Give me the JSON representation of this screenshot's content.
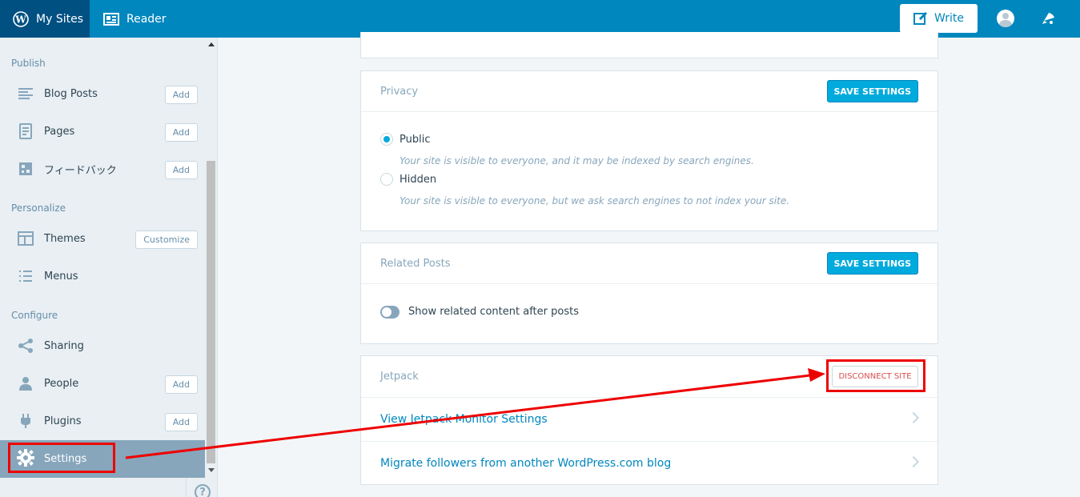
{
  "masterbar": {
    "my_sites": "My Sites",
    "reader": "Reader",
    "write": "Write"
  },
  "sidebar": {
    "sections": [
      {
        "heading": "Publish",
        "items": [
          {
            "label": "Blog Posts",
            "icon": "posts-icon",
            "button": "Add"
          },
          {
            "label": "Pages",
            "icon": "pages-icon",
            "button": "Add"
          },
          {
            "label": "フィードバック",
            "icon": "feedback-icon",
            "button": "Add"
          }
        ]
      },
      {
        "heading": "Personalize",
        "items": [
          {
            "label": "Themes",
            "icon": "themes-icon",
            "button": "Customize"
          },
          {
            "label": "Menus",
            "icon": "menus-icon",
            "button": ""
          }
        ]
      },
      {
        "heading": "Configure",
        "items": [
          {
            "label": "Sharing",
            "icon": "share-icon",
            "button": ""
          },
          {
            "label": "People",
            "icon": "person-icon",
            "button": "Add"
          },
          {
            "label": "Plugins",
            "icon": "plug-icon",
            "button": "Add"
          },
          {
            "label": "Settings",
            "icon": "gear-icon",
            "button": "",
            "active": true
          }
        ]
      }
    ],
    "help": "?"
  },
  "privacy": {
    "title": "Privacy",
    "save_label": "SAVE SETTINGS",
    "options": [
      {
        "label": "Public",
        "description": "Your site is visible to everyone, and it may be indexed by search engines.",
        "checked": true
      },
      {
        "label": "Hidden",
        "description": "Your site is visible to everyone, but we ask search engines to not index your site.",
        "checked": false
      }
    ]
  },
  "related_posts": {
    "title": "Related Posts",
    "save_label": "SAVE SETTINGS",
    "toggle_label": "Show related content after posts",
    "toggle_on": false
  },
  "jetpack": {
    "title": "Jetpack",
    "disconnect_label": "DISCONNECT SITE",
    "links": [
      "View Jetpack Monitor Settings",
      "Migrate followers from another WordPress.com blog"
    ]
  },
  "colors": {
    "masterbar": "#0087be",
    "primary_button": "#00aadc",
    "annotation": "#ee0000"
  }
}
